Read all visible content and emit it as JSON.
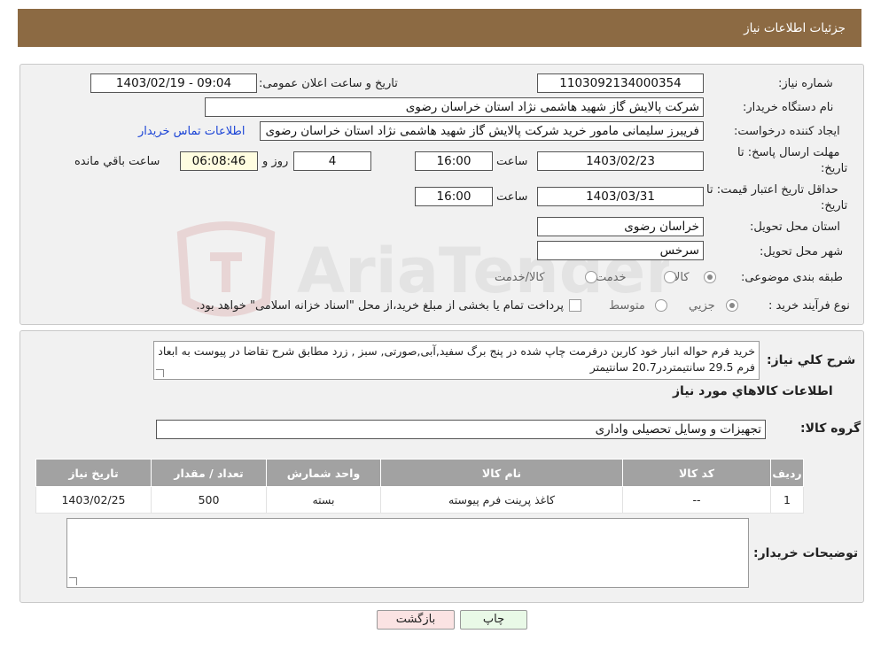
{
  "header": {
    "title": "جزئیات اطلاعات نیاز"
  },
  "form": {
    "need_number_label": "شماره نیاز:",
    "need_number": "1103092134000354",
    "announce_label": "تاریخ و ساعت اعلان عمومی:",
    "announce_value": "1403/02/19 - 09:04",
    "buyer_org_label": "نام دستگاه خریدار:",
    "buyer_org": "شرکت پالایش گاز شهید هاشمی نژاد   استان خراسان رضوی",
    "creator_label": "ایجاد کننده درخواست:",
    "creator": "فریبرز  سلیمانی مامور خرید شرکت پالایش گاز شهید هاشمی نژاد   استان خراسان رضوی",
    "contact_link": "اطلاعات تماس خریدار",
    "deadline_label_1": "مهلت ارسال پاسخ: تا",
    "deadline_label_2": "تاریخ:",
    "deadline_date": "1403/02/23",
    "time_label": "ساعت",
    "deadline_time": "16:00",
    "days_value": "4",
    "days_label": "روز و",
    "remaining_time": "06:08:46",
    "remaining_label": "ساعت باقي مانده",
    "validity_label_1": "حداقل تاریخ اعتبار قیمت: تا",
    "validity_label_2": "تاریخ:",
    "validity_date": "1403/03/31",
    "validity_time": "16:00",
    "province_label": "استان محل تحویل:",
    "province": "خراسان رضوی",
    "city_label": "شهر محل تحویل:",
    "city": "سرخس",
    "category_label": "طبقه بندی موضوعی:",
    "category_options": [
      "کالا",
      "خدمت",
      "کالا/خدمت"
    ],
    "category_selected": "کالا",
    "process_label": "نوع فرآیند خرید :",
    "process_options": [
      "جزیي",
      "متوسط"
    ],
    "process_selected": "جزیي",
    "process_note": "پرداخت تمام یا بخشی از مبلغ خرید،از محل \"اسناد خزانه اسلامی\" خواهد بود."
  },
  "description": {
    "label": "شرح کلي نياز:",
    "text": "خرید فرم حواله انبار خود کاربن درفرمت چاپ شده در پنج برگ سفید,آبی,صورتی, سبز , زرد  مطابق شرح تقاضا در پیوست به ابعاد فرم 29.5 سانتیمتردر20.7 سانتیمتر"
  },
  "goods": {
    "section_title": "اطلاعات کالاهاي مورد نياز",
    "group_label": "گروه کالا:",
    "group_value": "تجهیزات و وسایل تحصیلی واداری",
    "columns": [
      "ردیف",
      "کد کالا",
      "نام کالا",
      "واحد شمارش",
      "تعداد / مقدار",
      "تاریخ نیاز"
    ],
    "rows": [
      {
        "index": "1",
        "code": "--",
        "name": "کاغذ پرینت فرم پیوسته",
        "unit": "بسته",
        "qty": "500",
        "date": "1403/02/25"
      }
    ]
  },
  "buyer_notes": {
    "label": "توضیحات خریدار:",
    "value": ""
  },
  "buttons": {
    "print": "چاپ",
    "back": "بازگشت"
  },
  "colors": {
    "header_bg": "#8c6a43",
    "panel_bg": "#f1f1f1",
    "table_header_bg": "#a2a2a2",
    "link": "#1b44d6",
    "print_btn": "#e9f9e7",
    "back_btn": "#fbe3e3"
  }
}
